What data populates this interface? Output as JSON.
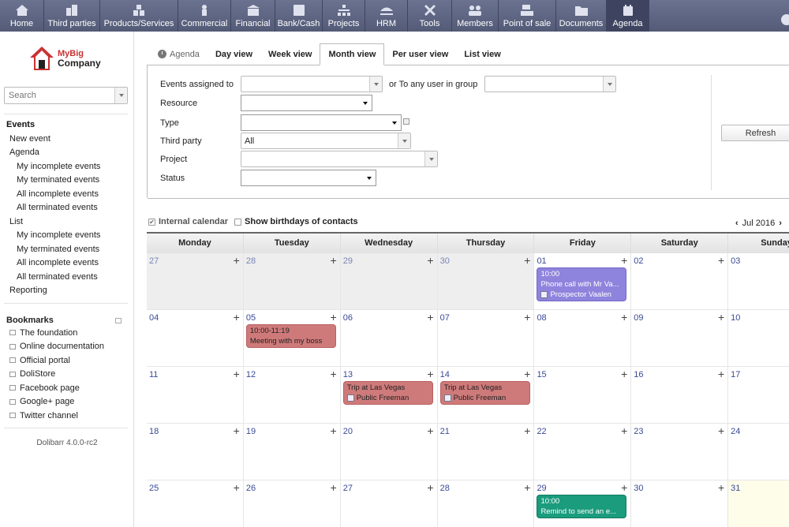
{
  "topmenu": [
    {
      "label": "Home",
      "icon": "home-icon",
      "width": 56
    },
    {
      "label": "Third parties",
      "icon": "buildings-icon",
      "width": 71
    },
    {
      "label": "Products/Services",
      "icon": "cubes-icon",
      "width": 99
    },
    {
      "label": "Commercial",
      "icon": "handshake-icon",
      "width": 67
    },
    {
      "label": "Financial",
      "icon": "bank-icon",
      "width": 56
    },
    {
      "label": "Bank/Cash",
      "icon": "safe-icon",
      "width": 60
    },
    {
      "label": "Projects",
      "icon": "hierarchy-icon",
      "width": 54
    },
    {
      "label": "HRM",
      "icon": "beach-icon",
      "width": 54
    },
    {
      "label": "Tools",
      "icon": "tools-icon",
      "width": 56
    },
    {
      "label": "Members",
      "icon": "members-icon",
      "width": 59
    },
    {
      "label": "Point of sale",
      "icon": "cash-register-icon",
      "width": 73
    },
    {
      "label": "Documents",
      "icon": "folder-icon",
      "width": 64
    },
    {
      "label": "Agenda",
      "icon": "agenda-icon",
      "width": 54
    }
  ],
  "brand": {
    "line1": "MyBig",
    "line2": "Company"
  },
  "search": {
    "placeholder": "Search"
  },
  "sidebar": {
    "events_title": "Events",
    "items": [
      {
        "label": "New event",
        "level": 1
      },
      {
        "label": "Agenda",
        "level": 1
      },
      {
        "label": "My incomplete events",
        "level": 2
      },
      {
        "label": "My terminated events",
        "level": 2
      },
      {
        "label": "All incomplete events",
        "level": 2
      },
      {
        "label": "All terminated events",
        "level": 2
      },
      {
        "label": "List",
        "level": 1
      },
      {
        "label": "My incomplete events",
        "level": 2
      },
      {
        "label": "My terminated events",
        "level": 2
      },
      {
        "label": "All incomplete events",
        "level": 2
      },
      {
        "label": "All terminated events",
        "level": 2
      },
      {
        "label": "Reporting",
        "level": 1
      }
    ],
    "bookmarks_title": "Bookmarks",
    "bookmarks": [
      "The foundation",
      "Online documentation",
      "Official portal",
      "DoliStore",
      "Facebook page",
      "Google+ page",
      "Twitter channel"
    ],
    "version": "Dolibarr 4.0.0-rc2"
  },
  "tabs": {
    "agenda": "Agenda",
    "day": "Day view",
    "week": "Week view",
    "month": "Month view",
    "peruser": "Per user view",
    "list": "List view"
  },
  "filters": {
    "assigned_label": "Events assigned to",
    "group_label": "or To any user in group",
    "resource_label": "Resource",
    "type_label": "Type",
    "thirdparty_label": "Third party",
    "thirdparty_value": "All",
    "project_label": "Project",
    "status_label": "Status",
    "refresh_label": "Refresh"
  },
  "calendar": {
    "internal_label": "Internal calendar",
    "birthdays_label": "Show birthdays of contacts",
    "month": "Jul 2016",
    "days": [
      "Monday",
      "Tuesday",
      "Wednesday",
      "Thursday",
      "Friday",
      "Saturday",
      "Sunday"
    ],
    "weeks": [
      [
        "27",
        "28",
        "29",
        "30",
        "01",
        "02",
        "03"
      ],
      [
        "04",
        "05",
        "06",
        "07",
        "08",
        "09",
        "10"
      ],
      [
        "11",
        "12",
        "13",
        "14",
        "15",
        "16",
        "17"
      ],
      [
        "18",
        "19",
        "20",
        "21",
        "22",
        "23",
        "24"
      ],
      [
        "25",
        "26",
        "27",
        "28",
        "29",
        "30",
        "31"
      ]
    ],
    "events": [
      {
        "week": 0,
        "day": 4,
        "color": "purple",
        "line1": "10:00",
        "line2": "Phone call with Mr Va...",
        "who": "Prospector Vaalen"
      },
      {
        "week": 1,
        "day": 1,
        "color": "red",
        "line1": "10:00-11:19",
        "line2": "Meeting with my boss",
        "who": ""
      },
      {
        "week": 2,
        "day": 2,
        "color": "red",
        "line1": "Trip at Las Vegas",
        "line2": "",
        "who": "Public Freeman"
      },
      {
        "week": 2,
        "day": 3,
        "color": "red",
        "line1": "Trip at Las Vegas",
        "line2": "",
        "who": "Public Freeman"
      },
      {
        "week": 4,
        "day": 4,
        "color": "green",
        "line1": "10:00",
        "line2": "Remind to send an e...",
        "who": ""
      }
    ],
    "colors": {
      "red": "#cf7a7a",
      "purple": "#8e84dd",
      "green": "#1a9c7d"
    }
  }
}
